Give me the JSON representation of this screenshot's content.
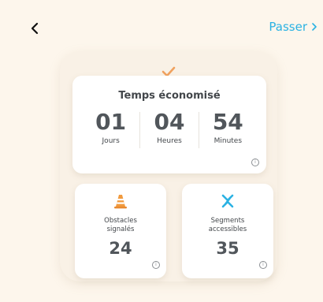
{
  "header": {
    "back_icon": "chevron-left-icon",
    "skip_label": "Passer",
    "skip_icon": "chevron-right-icon",
    "accent_color": "#2bb2e3"
  },
  "time_saved": {
    "icon": "checkmark-icon",
    "title": "Temps économisé",
    "units": [
      {
        "value": "01",
        "label": "Jours"
      },
      {
        "value": "04",
        "label": "Heures"
      },
      {
        "value": "54",
        "label": "Minutes"
      }
    ],
    "info_icon": "info-icon"
  },
  "obstacles": {
    "icon": "traffic-cone-icon",
    "label_line1": "Obstacles",
    "label_line2": "signalés",
    "value": "24",
    "info_icon": "info-icon"
  },
  "segments": {
    "icon": "accessible-segments-icon",
    "label_line1": "Segments",
    "label_line2": "accessibles",
    "value": "35",
    "info_icon": "info-icon"
  },
  "colors": {
    "background": "#fdf6ec",
    "check": "#f0a15e",
    "cone": "#f19a3e",
    "segments_icon": "#2bb2e3"
  }
}
